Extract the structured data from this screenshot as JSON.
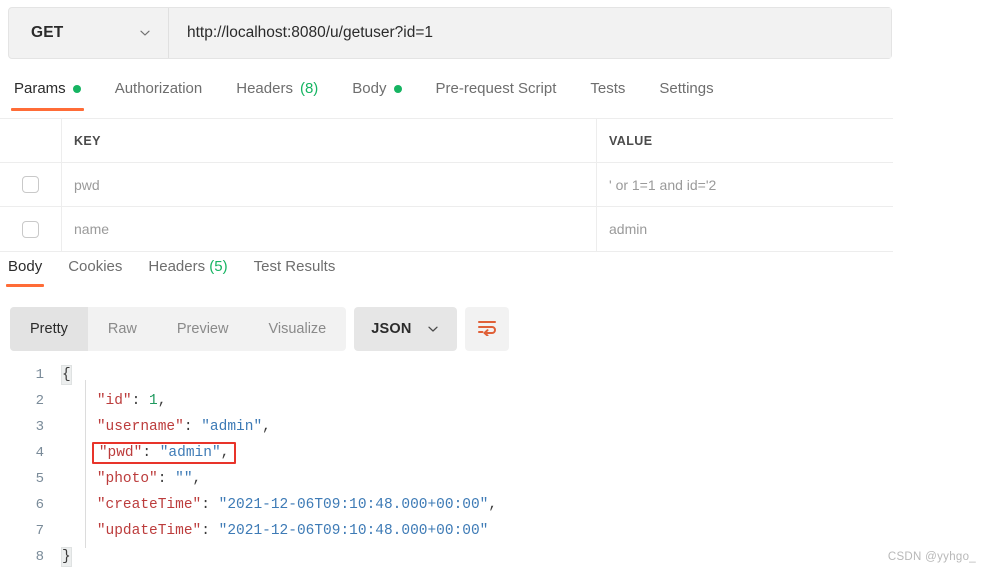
{
  "request": {
    "method": "GET",
    "url": "http://localhost:8080/u/getuser?id=1",
    "tabs": [
      {
        "label": "Params",
        "badge": "dot",
        "active": true
      },
      {
        "label": "Authorization",
        "badge": "",
        "active": false
      },
      {
        "label": "Headers",
        "count": "(8)",
        "active": false
      },
      {
        "label": "Body",
        "badge": "dot",
        "active": false
      },
      {
        "label": "Pre-request Script",
        "badge": "",
        "active": false
      },
      {
        "label": "Tests",
        "badge": "",
        "active": false
      },
      {
        "label": "Settings",
        "badge": "",
        "active": false
      }
    ],
    "params": {
      "header_key": "KEY",
      "header_value": "VALUE",
      "rows": [
        {
          "key": "pwd",
          "value": "' or 1=1 and id='2",
          "checked": false
        },
        {
          "key": "name",
          "value": "admin",
          "checked": false
        }
      ]
    }
  },
  "response": {
    "tabs": [
      {
        "label": "Body",
        "count": "",
        "active": true
      },
      {
        "label": "Cookies",
        "count": "",
        "active": false
      },
      {
        "label": "Headers",
        "count": "(5)",
        "active": false
      },
      {
        "label": "Test Results",
        "count": "",
        "active": false
      }
    ],
    "view_modes": [
      {
        "label": "Pretty",
        "active": true
      },
      {
        "label": "Raw",
        "active": false
      },
      {
        "label": "Preview",
        "active": false
      },
      {
        "label": "Visualize",
        "active": false
      }
    ],
    "format": "JSON",
    "body_lines": [
      {
        "no": "1",
        "text": "{"
      },
      {
        "no": "2",
        "text": "    \"id\": 1,"
      },
      {
        "no": "3",
        "text": "    \"username\": \"admin\","
      },
      {
        "no": "4",
        "text": "    \"pwd\": \"admin\","
      },
      {
        "no": "5",
        "text": "    \"photo\": \"\","
      },
      {
        "no": "6",
        "text": "    \"createTime\": \"2021-12-06T09:10:48.000+00:00\","
      },
      {
        "no": "7",
        "text": "    \"updateTime\": \"2021-12-06T09:10:48.000+00:00\""
      },
      {
        "no": "8",
        "text": "}"
      }
    ],
    "highlighted_line": "4",
    "body_tokens": {
      "l2_key": "\"id\"",
      "l2_num": "1",
      "l3_key": "\"username\"",
      "l3_val": "\"admin\"",
      "l4_key": "\"pwd\"",
      "l4_val": "\"admin\"",
      "l5_key": "\"photo\"",
      "l5_val": "\"\"",
      "l6_key": "\"createTime\"",
      "l6_val": "\"2021-12-06T09:10:48.000+00:00\"",
      "l7_key": "\"updateTime\"",
      "l7_val": "\"2021-12-06T09:10:48.000+00:00\"",
      "open_brace": "{",
      "close_brace": "}",
      "colon_sp": ": ",
      "comma": ",",
      "indent": "    "
    }
  },
  "watermark": "CSDN @yyhgo_",
  "colors": {
    "accent_orange": "#ff6c37",
    "status_green": "#16b462",
    "key_red": "#bc3c3c",
    "string_blue": "#3e7bb6",
    "number_green": "#1f9a5f",
    "highlight_red": "#e8342a"
  }
}
